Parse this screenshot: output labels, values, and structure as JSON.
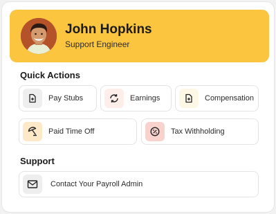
{
  "profile": {
    "name": "John Hopkins",
    "title": "Support Engineer"
  },
  "quick_actions": {
    "heading": "Quick Actions",
    "items": [
      {
        "label": "Pay Stubs",
        "icon": "document-plus-icon",
        "icon_bg": "#eeeeee"
      },
      {
        "label": "Earnings",
        "icon": "refresh-arrows-icon",
        "icon_bg": "#fdeeea"
      },
      {
        "label": "Compensation",
        "icon": "document-plus-icon",
        "icon_bg": "#fdf7e6"
      },
      {
        "label": "Paid Time Off",
        "icon": "beach-umbrella-icon",
        "icon_bg": "#fde8c8"
      },
      {
        "label": "Tax Withholding",
        "icon": "percent-badge-icon",
        "icon_bg": "#f8d3ce"
      }
    ]
  },
  "support": {
    "heading": "Support",
    "contact_label": "Contact Your Payroll Admin",
    "icon": "mail-icon",
    "icon_bg": "#eeeeee"
  },
  "colors": {
    "header_bg": "#fcc53f",
    "accent_red": "#d9534f"
  }
}
